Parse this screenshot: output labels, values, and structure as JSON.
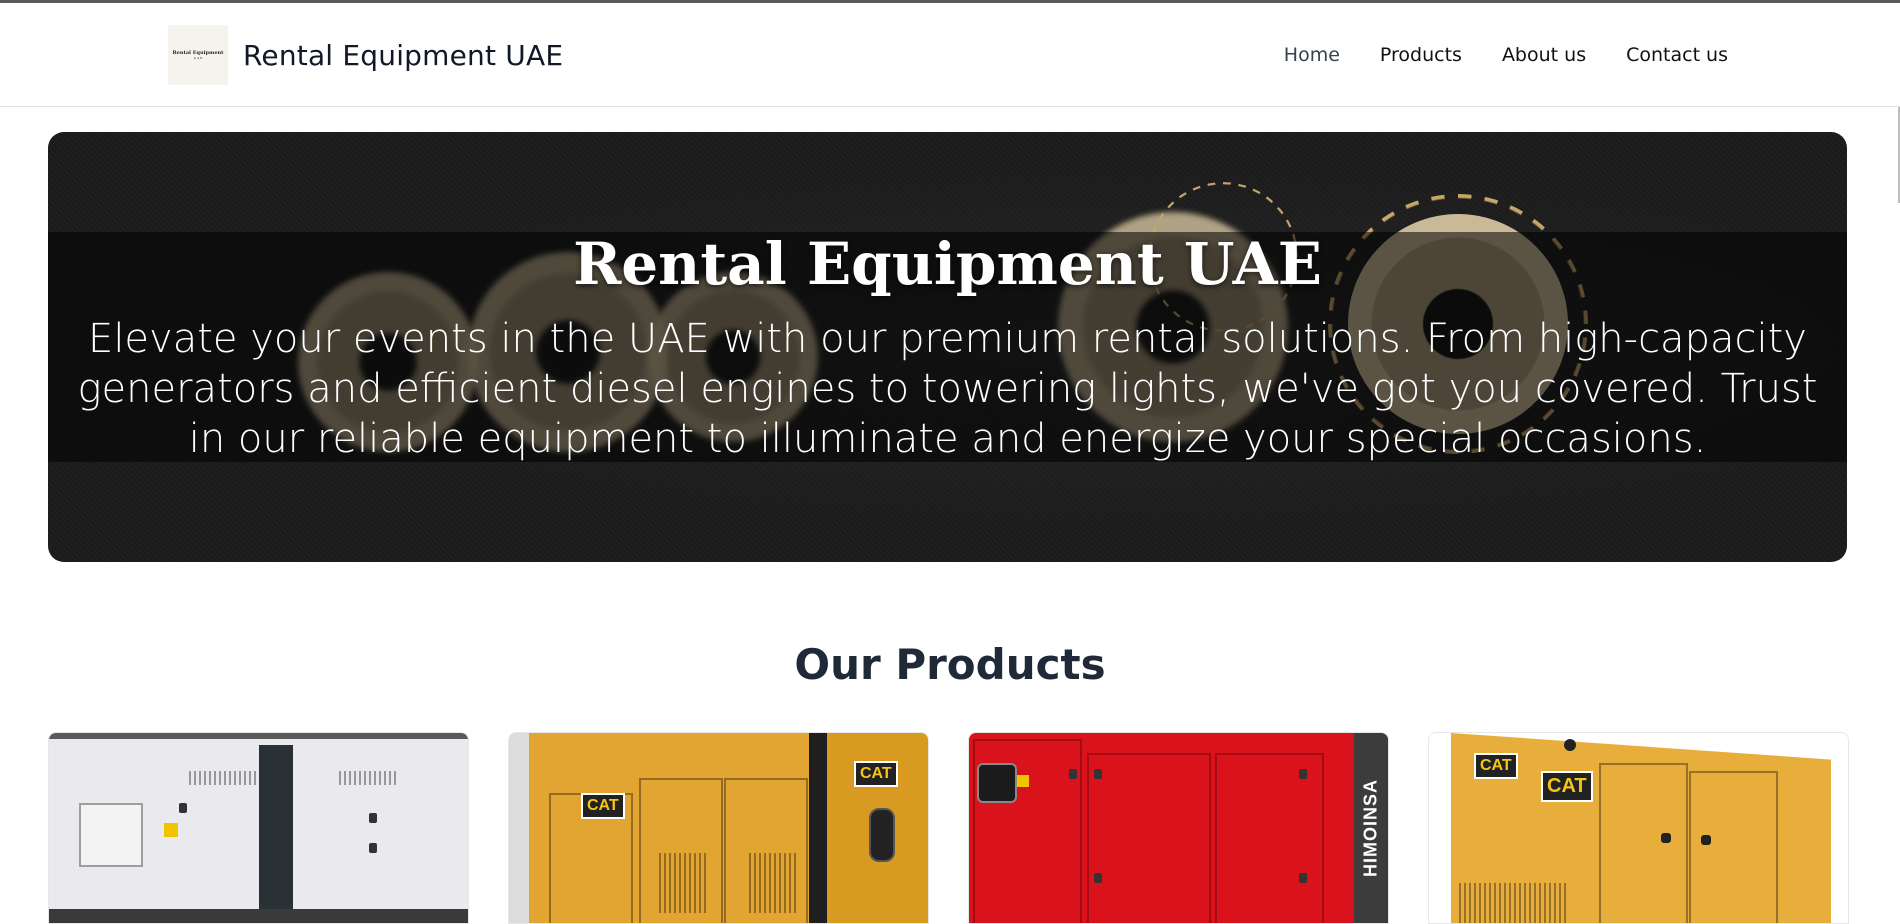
{
  "site": {
    "brand_title": "Rental Equipment UAE",
    "logo_text_line1": "Rental Equipment",
    "logo_text_line2": "U A E"
  },
  "nav": {
    "items": [
      {
        "label": "Home",
        "active": true
      },
      {
        "label": "Products",
        "active": false
      },
      {
        "label": "About us",
        "active": false
      },
      {
        "label": "Contact us",
        "active": false
      }
    ]
  },
  "hero": {
    "title": "Rental Equipment UAE",
    "text": "Elevate your events in the UAE with our premium rental solutions. From high-capacity generators and efficient diesel engines to towering lights, we've got you covered. Trust in our reliable equipment to illuminate and energize your special occasions."
  },
  "products": {
    "section_title": "Our Products",
    "cards": [
      {
        "image": "white-generator"
      },
      {
        "image": "cat-yellow-generator",
        "badge": "CAT"
      },
      {
        "image": "himoinsa-red-generator",
        "brand_text": "HIMOINSA"
      },
      {
        "image": "cat-yellow-generator-2",
        "badge": "CAT"
      }
    ]
  },
  "colors": {
    "heading": "#1f2937",
    "hero_bg": "#1b1b1b",
    "yellow_generator": "#e8a92d",
    "red_generator": "#d9121c",
    "white_generator": "#e9e9ee"
  }
}
